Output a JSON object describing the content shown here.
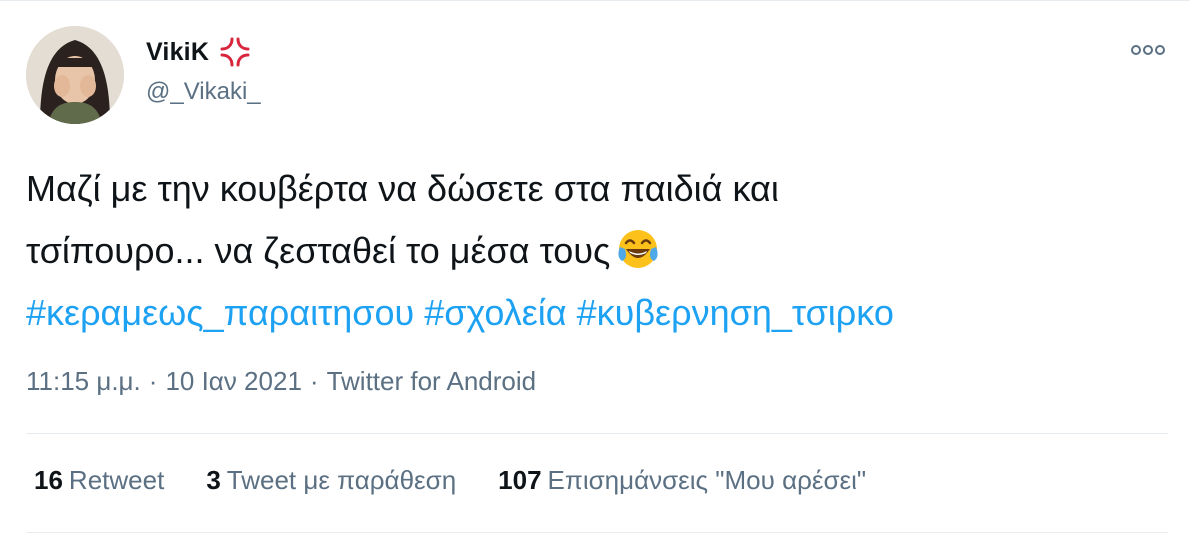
{
  "tweet": {
    "author": {
      "display_name": "VikiK",
      "handle": "@_Vikaki_",
      "badge_icon": "anger-symbol-icon",
      "avatar": "avatar"
    },
    "text_lines": [
      "Μαζί με την κουβέρτα να δώσετε στα παιδιά και",
      "τσίπουρο... να ζεσταθεί το μέσα τους"
    ],
    "emoji": "face-with-tears-of-joy-icon",
    "hashtags": [
      "#κεραμεως_παραιτησου",
      "#σχολεία",
      "#κυβερνηση_τσιρκο"
    ],
    "timestamp": "11:15 μ.μ.",
    "date": "10 Ιαν 2021",
    "separator": "·",
    "source": "Twitter for Android",
    "stats": {
      "retweets": {
        "count": "16",
        "label": "Retweet"
      },
      "quotes": {
        "count": "3",
        "label": "Tweet με παράθεση"
      },
      "likes": {
        "count": "107",
        "label": "Επισημάνσεις \"Μου αρέσει\""
      }
    },
    "colors": {
      "hashtag": "#1da1f2",
      "secondary_text": "#5b7083",
      "primary_text": "#0f1419",
      "divider": "#e6ecf0"
    }
  }
}
